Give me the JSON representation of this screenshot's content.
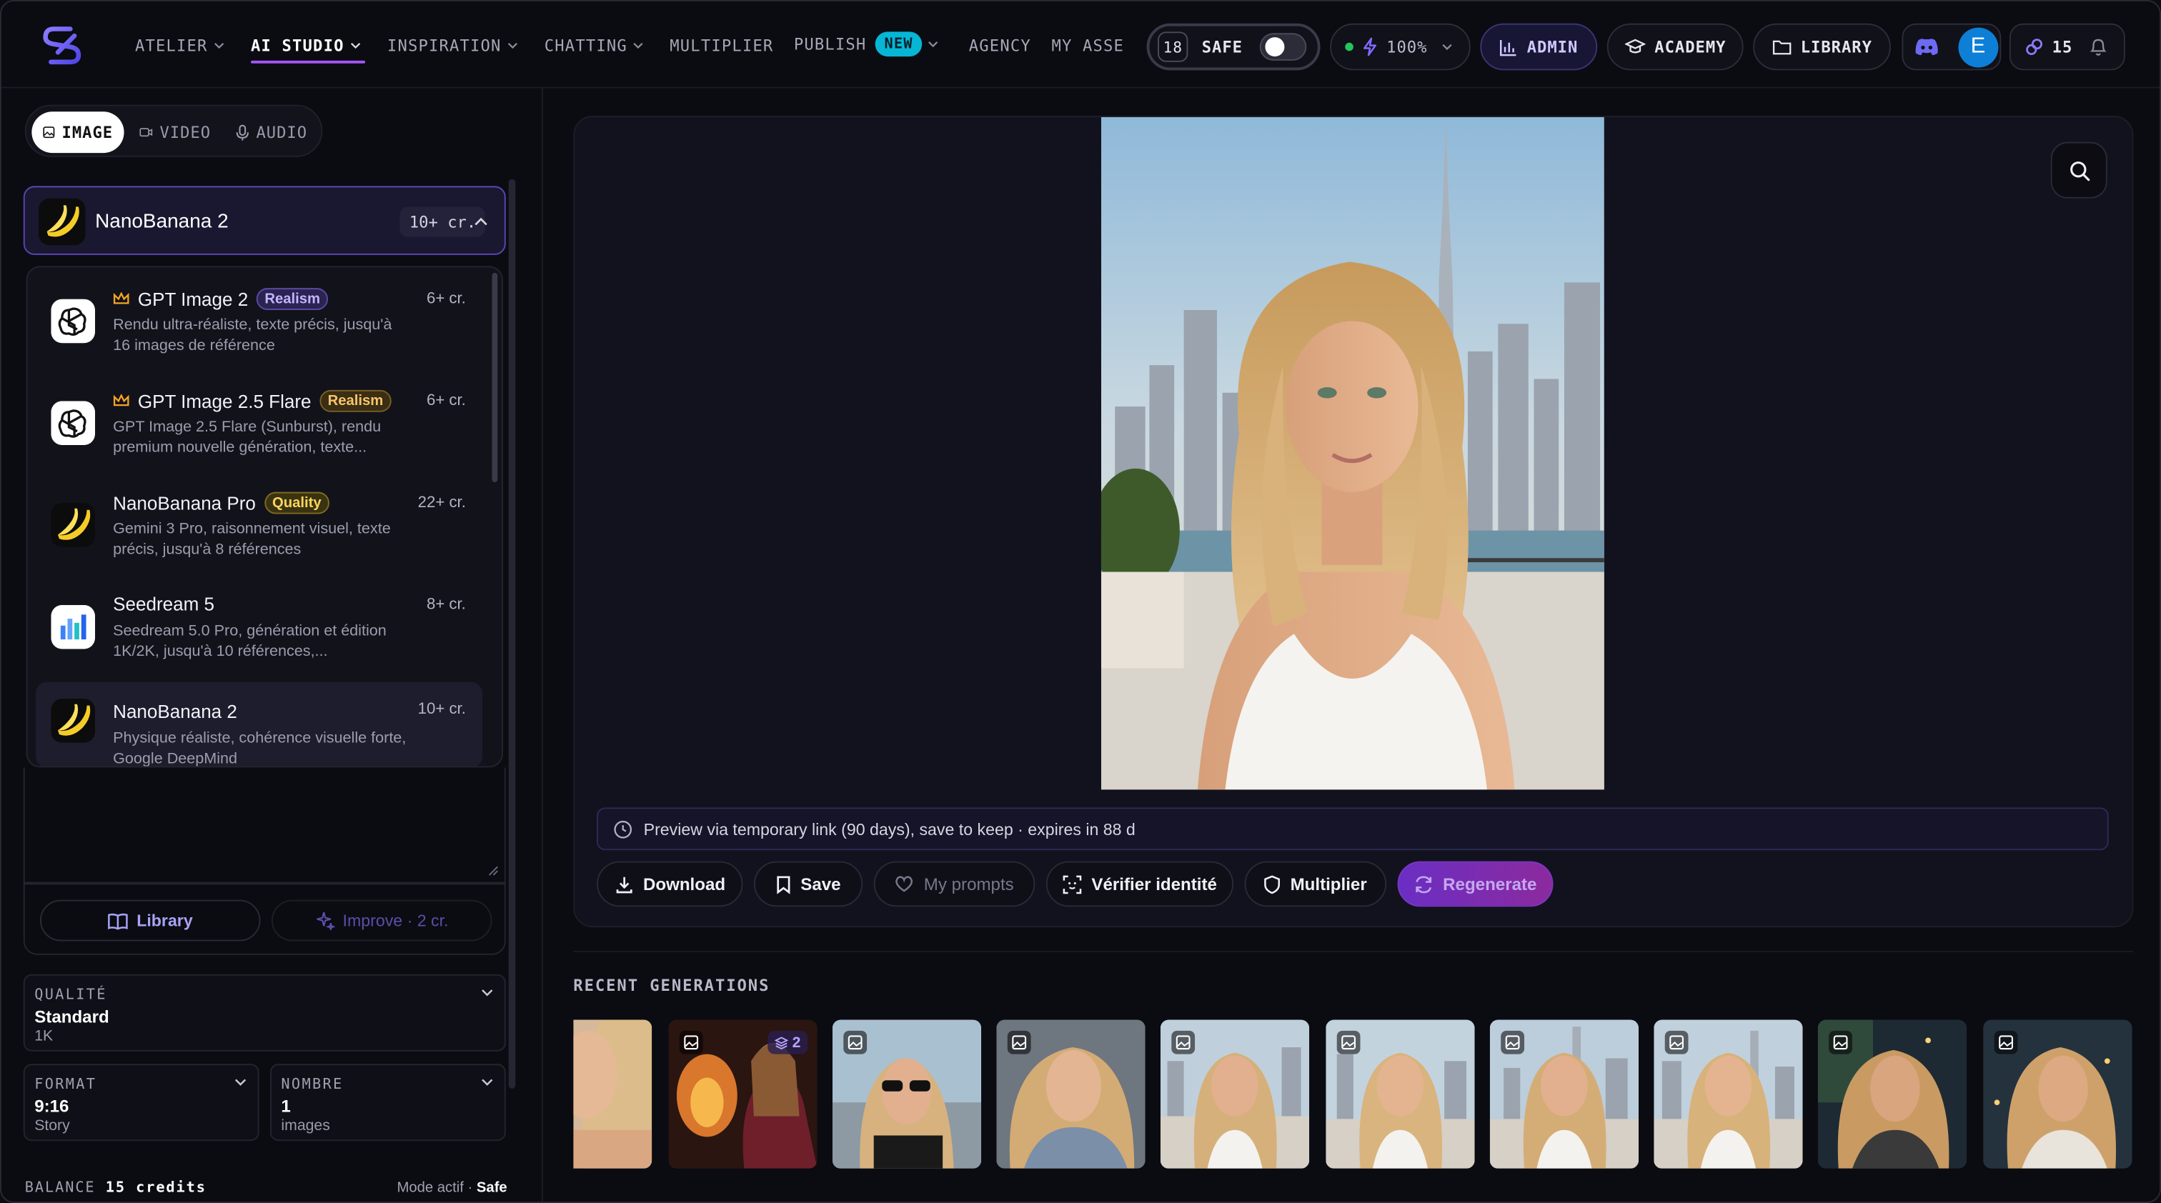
{
  "nav": {
    "items": [
      {
        "label": "ATELIER",
        "chevron": true
      },
      {
        "label": "AI STUDIO",
        "chevron": true,
        "active": true
      },
      {
        "label": "INSPIRATION",
        "chevron": true
      },
      {
        "label": "CHATTING",
        "chevron": true
      },
      {
        "label": "MULTIPLIER",
        "chevron": false
      },
      {
        "label": "PUBLISH",
        "chevron": true,
        "badge": "NEW"
      },
      {
        "label": "AGENCY",
        "chevron": false
      },
      {
        "label": "MY ASSE",
        "chevron": false
      }
    ],
    "age_value": "18",
    "safe_label": "SAFE",
    "power_value": "100%",
    "admin_label": "ADMIN",
    "academy_label": "ACADEMY",
    "library_label": "LIBRARY",
    "avatar_letter": "E",
    "credits_value": "15"
  },
  "sidebar": {
    "tabs": [
      "IMAGE",
      "VIDEO",
      "AUDIO"
    ],
    "selected_model": {
      "name": "NanoBanana 2",
      "cost": "10+ cr."
    },
    "models": [
      {
        "name": "GPT Image 2",
        "premium": true,
        "tag": "Realism",
        "tag_style": "realism-blue",
        "cost": "6+ cr.",
        "desc": "Rendu ultra-réaliste, texte précis, jusqu'à 16 images de référence",
        "icon": "openai"
      },
      {
        "name": "GPT Image 2.5 Flare",
        "premium": true,
        "tag": "Realism",
        "tag_style": "realism-gold",
        "cost": "6+ cr.",
        "desc": "GPT Image 2.5 Flare (Sunburst), rendu premium nouvelle génération, texte...",
        "icon": "openai"
      },
      {
        "name": "NanoBanana Pro",
        "premium": false,
        "tag": "Quality",
        "tag_style": "quality",
        "cost": "22+ cr.",
        "desc": "Gemini 3 Pro, raisonnement visuel, texte précis, jusqu'à 8 références",
        "icon": "banana"
      },
      {
        "name": "Seedream 5",
        "premium": false,
        "tag": "",
        "tag_style": "",
        "cost": "8+ cr.",
        "desc": "Seedream 5.0 Pro, génération et édition 1K/2K, jusqu'à 10 références,...",
        "icon": "seedream"
      },
      {
        "name": "NanoBanana 2",
        "premium": false,
        "tag": "",
        "tag_style": "",
        "cost": "10+ cr.",
        "desc": "Physique réaliste, cohérence visuelle forte, Google DeepMind",
        "icon": "banana",
        "selected": true
      }
    ],
    "library_label": "Library",
    "improve_label": "Improve · 2 cr.",
    "quality": {
      "label": "QUALITÉ",
      "value": "Standard",
      "sub": "1K"
    },
    "format": {
      "label": "FORMAT",
      "value": "9:16",
      "sub": "Story"
    },
    "count": {
      "label": "NOMBRE",
      "value": "1",
      "sub": "images"
    },
    "balance_label": "BALANCE",
    "balance_value": "15 credits",
    "mode_label": "Mode actif ·",
    "mode_value": "Safe"
  },
  "main": {
    "notice": "Preview via temporary link (90 days), save to keep · expires in 88 d",
    "actions": [
      "Download",
      "Save",
      "My prompts",
      "Vérifier identité",
      "Multiplier",
      "Regenerate"
    ],
    "recent_title": "RECENT GENERATIONS",
    "recent_badge_count": "2"
  },
  "colors": {
    "accent": "#a855f7",
    "new_badge": "#06b6d4",
    "avatar": "#0e7fd6"
  }
}
